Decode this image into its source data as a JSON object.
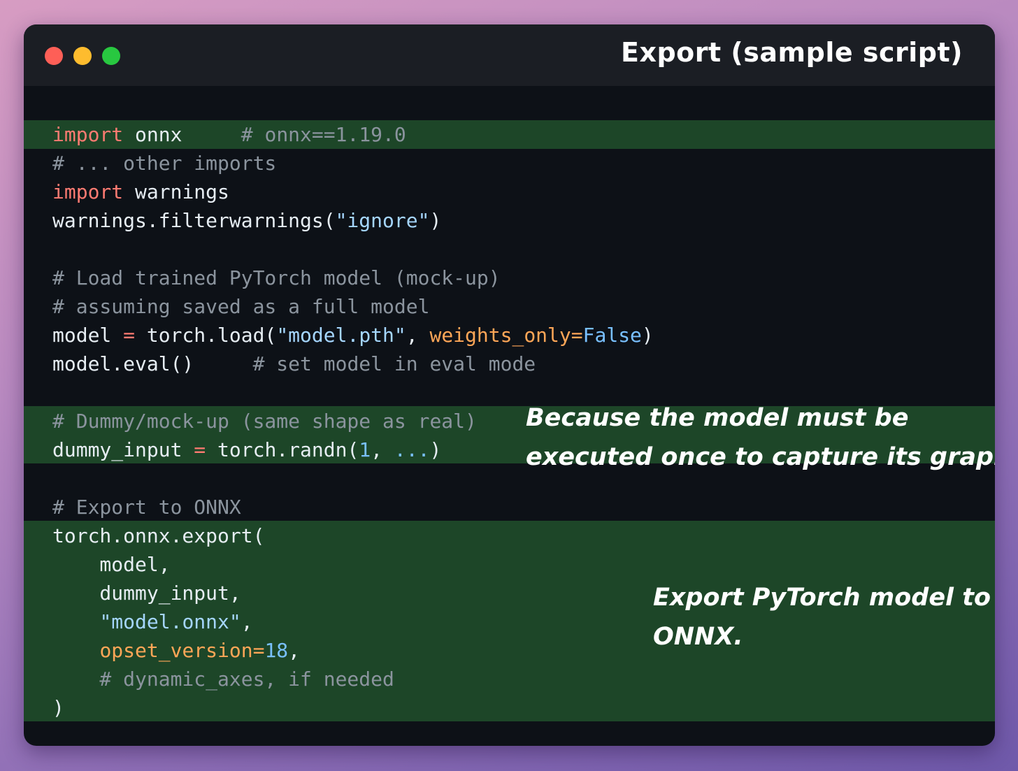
{
  "window": {
    "title": "Export (sample script)",
    "controls": [
      "close-dot",
      "minimize-dot",
      "maximize-dot"
    ]
  },
  "colors": {
    "background_gradient": [
      "#d79cc2",
      "#6f59aa"
    ],
    "window_bg": "#0d1117",
    "titlebar_bg": "#1b1e24",
    "highlight_bg": "#1d4628",
    "keyword": "#ff7b72",
    "comment": "#8b949e",
    "string": "#a5d6ff",
    "number": "#79c0ff",
    "argument": "#ffa657",
    "plain": "#e6edf3",
    "close": "#fe5f57",
    "minimize": "#febc2e",
    "maximize": "#28c840"
  },
  "code": {
    "l1_kw": "import",
    "l1_mod": " onnx",
    "l1_cm": "     # onnx==1.19.0",
    "l2_cm": "# ... other imports",
    "l3_kw": "import",
    "l3_mod": " warnings",
    "l4_a": "warnings.filterwarnings(",
    "l4_str": "\"ignore\"",
    "l4_b": ")",
    "l5_cm": "# Load trained PyTorch model (mock-up)",
    "l6_cm": "# assuming saved as a full model",
    "l7_a": "model ",
    "l7_op": "=",
    "l7_b": " torch.load(",
    "l7_str": "\"model.pth\"",
    "l7_c": ", ",
    "l7_arg": "weights_only=",
    "l7_val": "False",
    "l7_d": ")",
    "l8_a": "model.eval()",
    "l8_cm": "     # set model in eval mode",
    "l9_cm": "# Dummy/mock-up (same shape as real)",
    "l10_a": "dummy_input ",
    "l10_op": "=",
    "l10_b": " torch.randn(",
    "l10_num": "1",
    "l10_c": ", ",
    "l10_ell": "...",
    "l10_d": ")",
    "l11_cm": "# Export to ONNX",
    "l12_a": "torch.onnx.export(",
    "l13_a": "    model,",
    "l14_a": "    dummy_input,",
    "l15_ind": "    ",
    "l15_str": "\"model.onnx\"",
    "l15_b": ",",
    "l16_ind": "    ",
    "l16_arg": "opset_version=",
    "l16_num": "18",
    "l16_b": ",",
    "l17_cm": "    # dynamic_axes, if needed",
    "l18_a": ")"
  },
  "annotations": {
    "dummy_line1": "Because the model must be",
    "dummy_line2": "executed once to capture its graph.",
    "export_line1": "Export PyTorch model to",
    "export_line2": "ONNX."
  }
}
